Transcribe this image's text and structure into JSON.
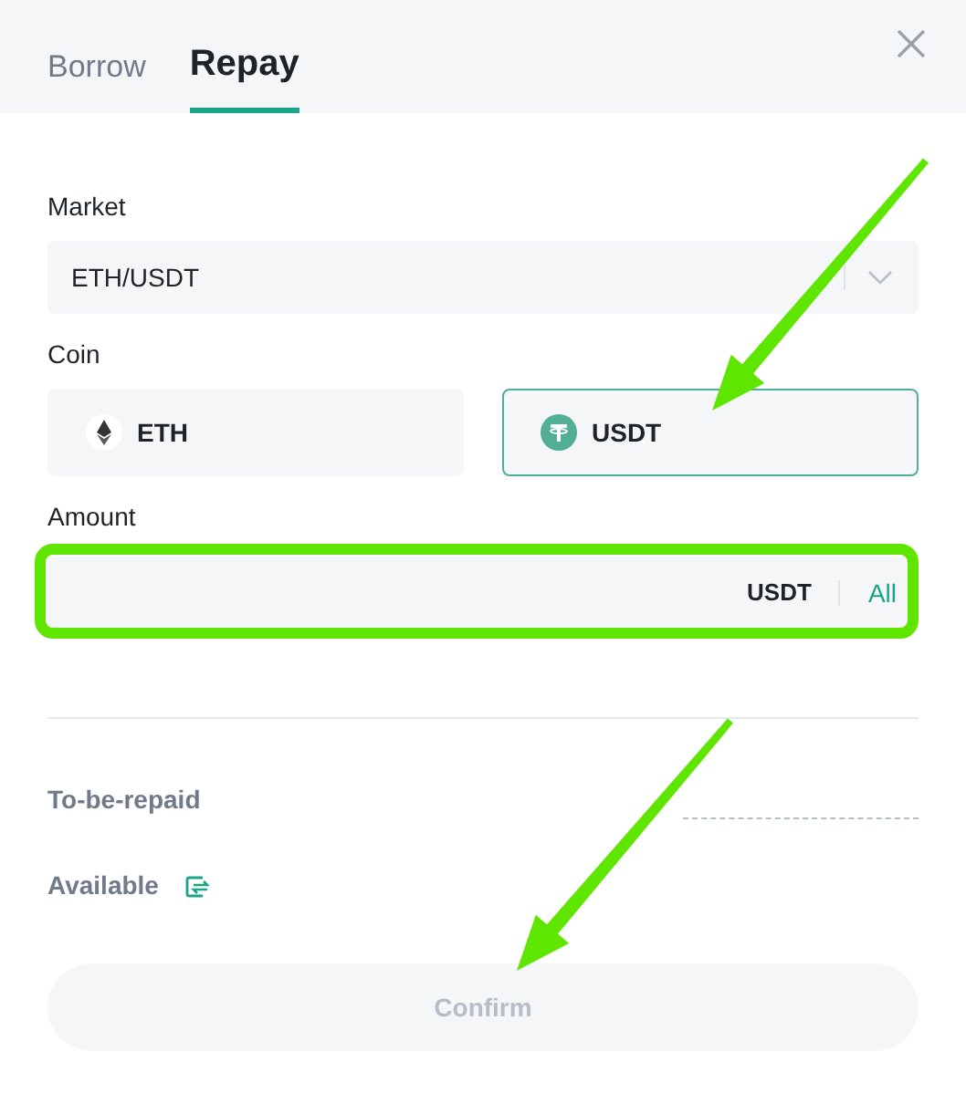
{
  "tabs": [
    {
      "label": "Borrow",
      "selected": false
    },
    {
      "label": "Repay",
      "selected": true
    }
  ],
  "market": {
    "label": "Market",
    "value": "ETH/USDT"
  },
  "coin": {
    "label": "Coin",
    "options": [
      {
        "kind": "eth",
        "label": "ETH",
        "selected": false
      },
      {
        "kind": "tether",
        "label": "USDT",
        "selected": true
      }
    ]
  },
  "amount": {
    "label": "Amount",
    "unit": "USDT",
    "all_link": "All"
  },
  "summary": {
    "to_be_repaid": "To-be-repaid",
    "available": "Available"
  },
  "confirm": {
    "label": "Confirm",
    "disabled": true
  }
}
